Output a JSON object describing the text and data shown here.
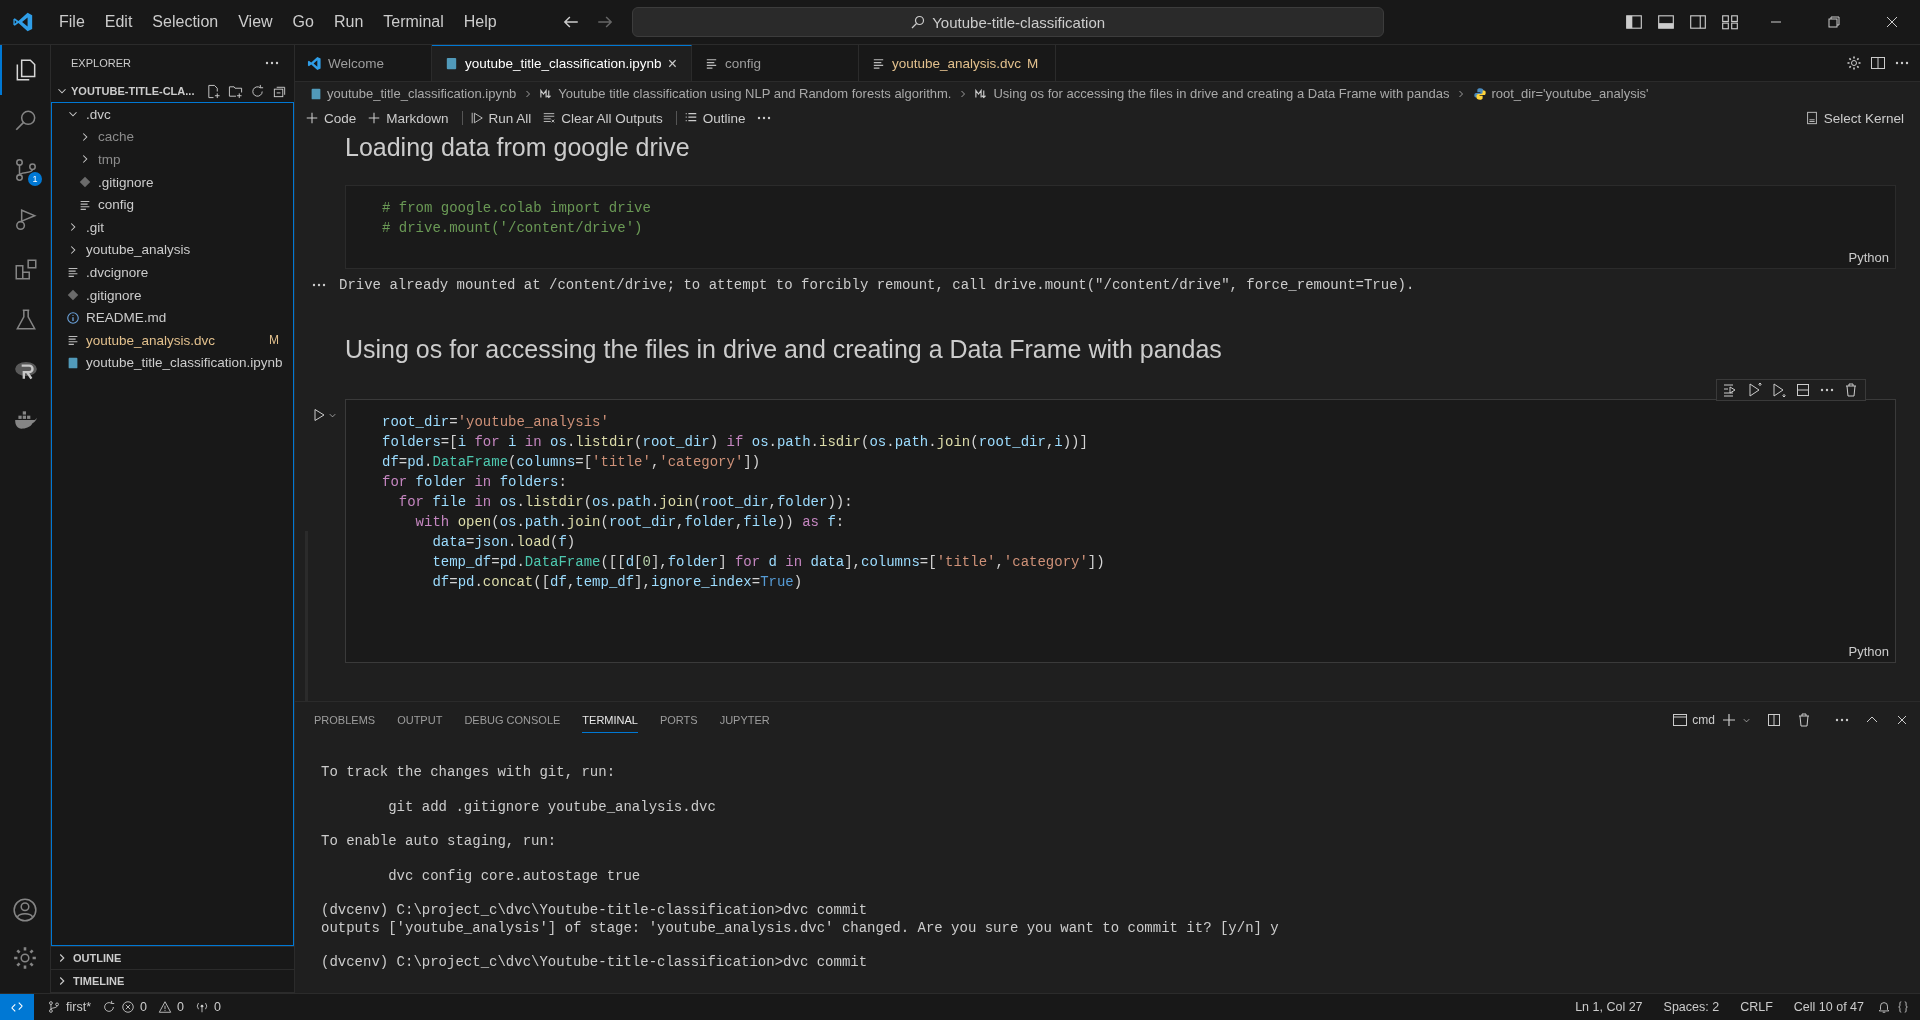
{
  "menu": [
    "File",
    "Edit",
    "Selection",
    "View",
    "Go",
    "Run",
    "Terminal",
    "Help"
  ],
  "command_center": {
    "value": "Youtube-title-classification"
  },
  "activity_bar": [
    {
      "kind": "files",
      "selected": true
    },
    {
      "kind": "search",
      "selected": false
    },
    {
      "kind": "scm",
      "selected": false,
      "badge": "1"
    },
    {
      "kind": "debug",
      "selected": false
    },
    {
      "kind": "extensions",
      "selected": false
    },
    {
      "kind": "testing",
      "selected": false
    },
    {
      "kind": "r",
      "selected": false
    },
    {
      "kind": "docker",
      "selected": false
    }
  ],
  "explorer": {
    "title": "EXPLORER",
    "folder": "YOUTUBE-TITLE-CLA...",
    "tree": [
      {
        "name": ".dvc",
        "kind": "folder",
        "expanded": true,
        "children": [
          {
            "name": "cache",
            "kind": "folder",
            "expanded": false,
            "ignored": true
          },
          {
            "name": "tmp",
            "kind": "folder",
            "expanded": false,
            "ignored": true
          },
          {
            "name": ".gitignore",
            "kind": "git"
          },
          {
            "name": "config",
            "kind": "lines"
          }
        ]
      },
      {
        "name": ".git",
        "kind": "folder",
        "expanded": false
      },
      {
        "name": "youtube_analysis",
        "kind": "folder",
        "expanded": false
      },
      {
        "name": ".dvcignore",
        "kind": "lines"
      },
      {
        "name": ".gitignore",
        "kind": "git"
      },
      {
        "name": "README.md",
        "kind": "info"
      },
      {
        "name": "youtube_analysis.dvc",
        "kind": "lines",
        "modified": true,
        "badge": "M"
      },
      {
        "name": "youtube_title_classification.ipynb",
        "kind": "notebook"
      }
    ]
  },
  "sidebar_sections": [
    {
      "label": "OUTLINE",
      "expanded": false
    },
    {
      "label": "TIMELINE",
      "expanded": false
    }
  ],
  "tabs": [
    {
      "label": "Welcome",
      "kind": "vscode",
      "selected": false
    },
    {
      "label": "youtube_title_classification.ipynb",
      "kind": "notebook",
      "selected": true,
      "close": "×"
    },
    {
      "label": "config",
      "kind": "lines",
      "selected": false
    },
    {
      "label": "youtube_analysis.dvc",
      "kind": "lines",
      "selected": false,
      "modified": true,
      "badge": "M"
    }
  ],
  "breadcrumbs": [
    {
      "label": "youtube_title_classification.ipynb",
      "kind": "notebook"
    },
    {
      "label": "Youtube title classification using NLP and Random forests algorithm.",
      "kind": "markdown"
    },
    {
      "label": "Using os for accessing the files in drive and creating a Data Frame with pandas",
      "kind": "markdown"
    },
    {
      "label": "root_dir='youtube_analysis'",
      "kind": "python"
    }
  ],
  "toolbar": [
    {
      "label": "Code",
      "kind": "plus"
    },
    {
      "label": "Markdown",
      "kind": "plus"
    },
    {
      "label": "Run All",
      "kind": "run"
    },
    {
      "label": "Clear All Outputs",
      "kind": "clear"
    },
    {
      "label": "Outline",
      "kind": "outline"
    }
  ],
  "kernel": "Select Kernel",
  "cells": [
    {
      "kind": "heading",
      "text": "Loading data from google drive"
    },
    {
      "kind": "code",
      "language": "Python",
      "focused": false,
      "lines": [
        [
          {
            "kind": "c",
            "text": "# from google.colab import drive"
          }
        ],
        [
          {
            "kind": "c",
            "text": "# drive.mount('/content/drive')"
          }
        ]
      ],
      "output": "Drive already mounted at /content/drive; to attempt to forcibly remount, call drive.mount(\"/content/drive\", force_remount=True)."
    },
    {
      "kind": "heading",
      "text": "Using os for accessing the files in drive and creating a Data Frame with pandas"
    },
    {
      "kind": "code",
      "language": "Python",
      "focused": true,
      "lines": [
        [
          {
            "kind": "v",
            "text": "root_dir"
          },
          {
            "kind": "p",
            "text": "="
          },
          {
            "kind": "s",
            "text": "'youtube_analysis'"
          }
        ],
        [
          {
            "kind": "v",
            "text": "folders"
          },
          {
            "kind": "p",
            "text": "=["
          },
          {
            "kind": "v",
            "text": "i"
          },
          {
            "kind": "k",
            "text": " for "
          },
          {
            "kind": "v",
            "text": "i"
          },
          {
            "kind": "k",
            "text": " in "
          },
          {
            "kind": "v",
            "text": "os"
          },
          {
            "kind": "p",
            "text": "."
          },
          {
            "kind": "f",
            "text": "listdir"
          },
          {
            "kind": "p",
            "text": "("
          },
          {
            "kind": "v",
            "text": "root_dir"
          },
          {
            "kind": "p",
            "text": ") "
          },
          {
            "kind": "k",
            "text": "if "
          },
          {
            "kind": "v",
            "text": "os"
          },
          {
            "kind": "p",
            "text": "."
          },
          {
            "kind": "v",
            "text": "path"
          },
          {
            "kind": "p",
            "text": "."
          },
          {
            "kind": "f",
            "text": "isdir"
          },
          {
            "kind": "p",
            "text": "("
          },
          {
            "kind": "v",
            "text": "os"
          },
          {
            "kind": "p",
            "text": "."
          },
          {
            "kind": "v",
            "text": "path"
          },
          {
            "kind": "p",
            "text": "."
          },
          {
            "kind": "f",
            "text": "join"
          },
          {
            "kind": "p",
            "text": "("
          },
          {
            "kind": "v",
            "text": "root_dir"
          },
          {
            "kind": "p",
            "text": ","
          },
          {
            "kind": "v",
            "text": "i"
          },
          {
            "kind": "p",
            "text": "))]"
          }
        ],
        [
          {
            "kind": "v",
            "text": "df"
          },
          {
            "kind": "p",
            "text": "="
          },
          {
            "kind": "v",
            "text": "pd"
          },
          {
            "kind": "p",
            "text": "."
          },
          {
            "kind": "n",
            "text": "DataFrame"
          },
          {
            "kind": "p",
            "text": "("
          },
          {
            "kind": "v",
            "text": "columns"
          },
          {
            "kind": "p",
            "text": "=["
          },
          {
            "kind": "s",
            "text": "'title'"
          },
          {
            "kind": "p",
            "text": ","
          },
          {
            "kind": "s",
            "text": "'category'"
          },
          {
            "kind": "p",
            "text": "])"
          }
        ],
        [
          {
            "kind": "k",
            "text": "for "
          },
          {
            "kind": "v",
            "text": "folder"
          },
          {
            "kind": "k",
            "text": " in "
          },
          {
            "kind": "v",
            "text": "folders"
          },
          {
            "kind": "p",
            "text": ":"
          }
        ],
        [
          {
            "kind": "k",
            "text": "  for "
          },
          {
            "kind": "v",
            "text": "file"
          },
          {
            "kind": "k",
            "text": " in "
          },
          {
            "kind": "v",
            "text": "os"
          },
          {
            "kind": "p",
            "text": "."
          },
          {
            "kind": "f",
            "text": "listdir"
          },
          {
            "kind": "p",
            "text": "("
          },
          {
            "kind": "v",
            "text": "os"
          },
          {
            "kind": "p",
            "text": "."
          },
          {
            "kind": "v",
            "text": "path"
          },
          {
            "kind": "p",
            "text": "."
          },
          {
            "kind": "f",
            "text": "join"
          },
          {
            "kind": "p",
            "text": "("
          },
          {
            "kind": "v",
            "text": "root_dir"
          },
          {
            "kind": "p",
            "text": ","
          },
          {
            "kind": "v",
            "text": "folder"
          },
          {
            "kind": "p",
            "text": ")):"
          }
        ],
        [
          {
            "kind": "k",
            "text": "    with "
          },
          {
            "kind": "f",
            "text": "open"
          },
          {
            "kind": "p",
            "text": "("
          },
          {
            "kind": "v",
            "text": "os"
          },
          {
            "kind": "p",
            "text": "."
          },
          {
            "kind": "v",
            "text": "path"
          },
          {
            "kind": "p",
            "text": "."
          },
          {
            "kind": "f",
            "text": "join"
          },
          {
            "kind": "p",
            "text": "("
          },
          {
            "kind": "v",
            "text": "root_dir"
          },
          {
            "kind": "p",
            "text": ","
          },
          {
            "kind": "v",
            "text": "folder"
          },
          {
            "kind": "p",
            "text": ","
          },
          {
            "kind": "v",
            "text": "file"
          },
          {
            "kind": "p",
            "text": ")) "
          },
          {
            "kind": "k",
            "text": "as "
          },
          {
            "kind": "v",
            "text": "f"
          },
          {
            "kind": "p",
            "text": ":"
          }
        ],
        [
          {
            "kind": "v",
            "text": "      data"
          },
          {
            "kind": "p",
            "text": "="
          },
          {
            "kind": "v",
            "text": "json"
          },
          {
            "kind": "p",
            "text": "."
          },
          {
            "kind": "f",
            "text": "load"
          },
          {
            "kind": "p",
            "text": "("
          },
          {
            "kind": "v",
            "text": "f"
          },
          {
            "kind": "p",
            "text": ")"
          }
        ],
        [
          {
            "kind": "v",
            "text": "      temp_df"
          },
          {
            "kind": "p",
            "text": "="
          },
          {
            "kind": "v",
            "text": "pd"
          },
          {
            "kind": "p",
            "text": "."
          },
          {
            "kind": "n",
            "text": "DataFrame"
          },
          {
            "kind": "p",
            "text": "([["
          },
          {
            "kind": "v",
            "text": "d"
          },
          {
            "kind": "p",
            "text": "["
          },
          {
            "kind": "m",
            "text": "0"
          },
          {
            "kind": "p",
            "text": "],"
          },
          {
            "kind": "v",
            "text": "folder"
          },
          {
            "kind": "p",
            "text": "] "
          },
          {
            "kind": "k",
            "text": "for "
          },
          {
            "kind": "v",
            "text": "d"
          },
          {
            "kind": "k",
            "text": " in "
          },
          {
            "kind": "v",
            "text": "data"
          },
          {
            "kind": "p",
            "text": "],"
          },
          {
            "kind": "v",
            "text": "columns"
          },
          {
            "kind": "p",
            "text": "=["
          },
          {
            "kind": "s",
            "text": "'title'"
          },
          {
            "kind": "p",
            "text": ","
          },
          {
            "kind": "s",
            "text": "'category'"
          },
          {
            "kind": "p",
            "text": "])"
          }
        ],
        [
          {
            "kind": "v",
            "text": "      df"
          },
          {
            "kind": "p",
            "text": "="
          },
          {
            "kind": "v",
            "text": "pd"
          },
          {
            "kind": "p",
            "text": "."
          },
          {
            "kind": "f",
            "text": "concat"
          },
          {
            "kind": "p",
            "text": "(["
          },
          {
            "kind": "v",
            "text": "df"
          },
          {
            "kind": "p",
            "text": ","
          },
          {
            "kind": "v",
            "text": "temp_df"
          },
          {
            "kind": "p",
            "text": "],"
          },
          {
            "kind": "v",
            "text": "ignore_index"
          },
          {
            "kind": "p",
            "text": "="
          },
          {
            "kind": "b",
            "text": "True"
          },
          {
            "kind": "p",
            "text": ")"
          }
        ]
      ]
    }
  ],
  "panel": {
    "tabs": [
      {
        "label": "PROBLEMS",
        "selected": false
      },
      {
        "label": "OUTPUT",
        "selected": false
      },
      {
        "label": "DEBUG CONSOLE",
        "selected": false
      },
      {
        "label": "TERMINAL",
        "selected": true
      },
      {
        "label": "PORTS",
        "selected": false
      },
      {
        "label": "JUPYTER",
        "selected": false
      }
    ],
    "shell": "cmd",
    "paragraphs": [
      [
        "To track the changes with git, run:"
      ],
      [
        "        git add .gitignore youtube_analysis.dvc"
      ],
      [
        "To enable auto staging, run:"
      ],
      [
        "        dvc config core.autostage true"
      ],
      [
        "(dvcenv) C:\\project_c\\dvc\\Youtube-title-classification>dvc commit",
        "outputs ['youtube_analysis'] of stage: 'youtube_analysis.dvc' changed. Are you sure you want to commit it? [y/n] y"
      ],
      [
        "(dvcenv) C:\\project_c\\dvc\\Youtube-title-classification>dvc commit"
      ]
    ]
  },
  "status_bar": {
    "branch": "first*",
    "errors": "0",
    "warnings": "0",
    "ports": "0",
    "right": [
      "Ln 1, Col 27",
      "Spaces: 2",
      "CRLF",
      "Cell 10 of 47"
    ]
  }
}
